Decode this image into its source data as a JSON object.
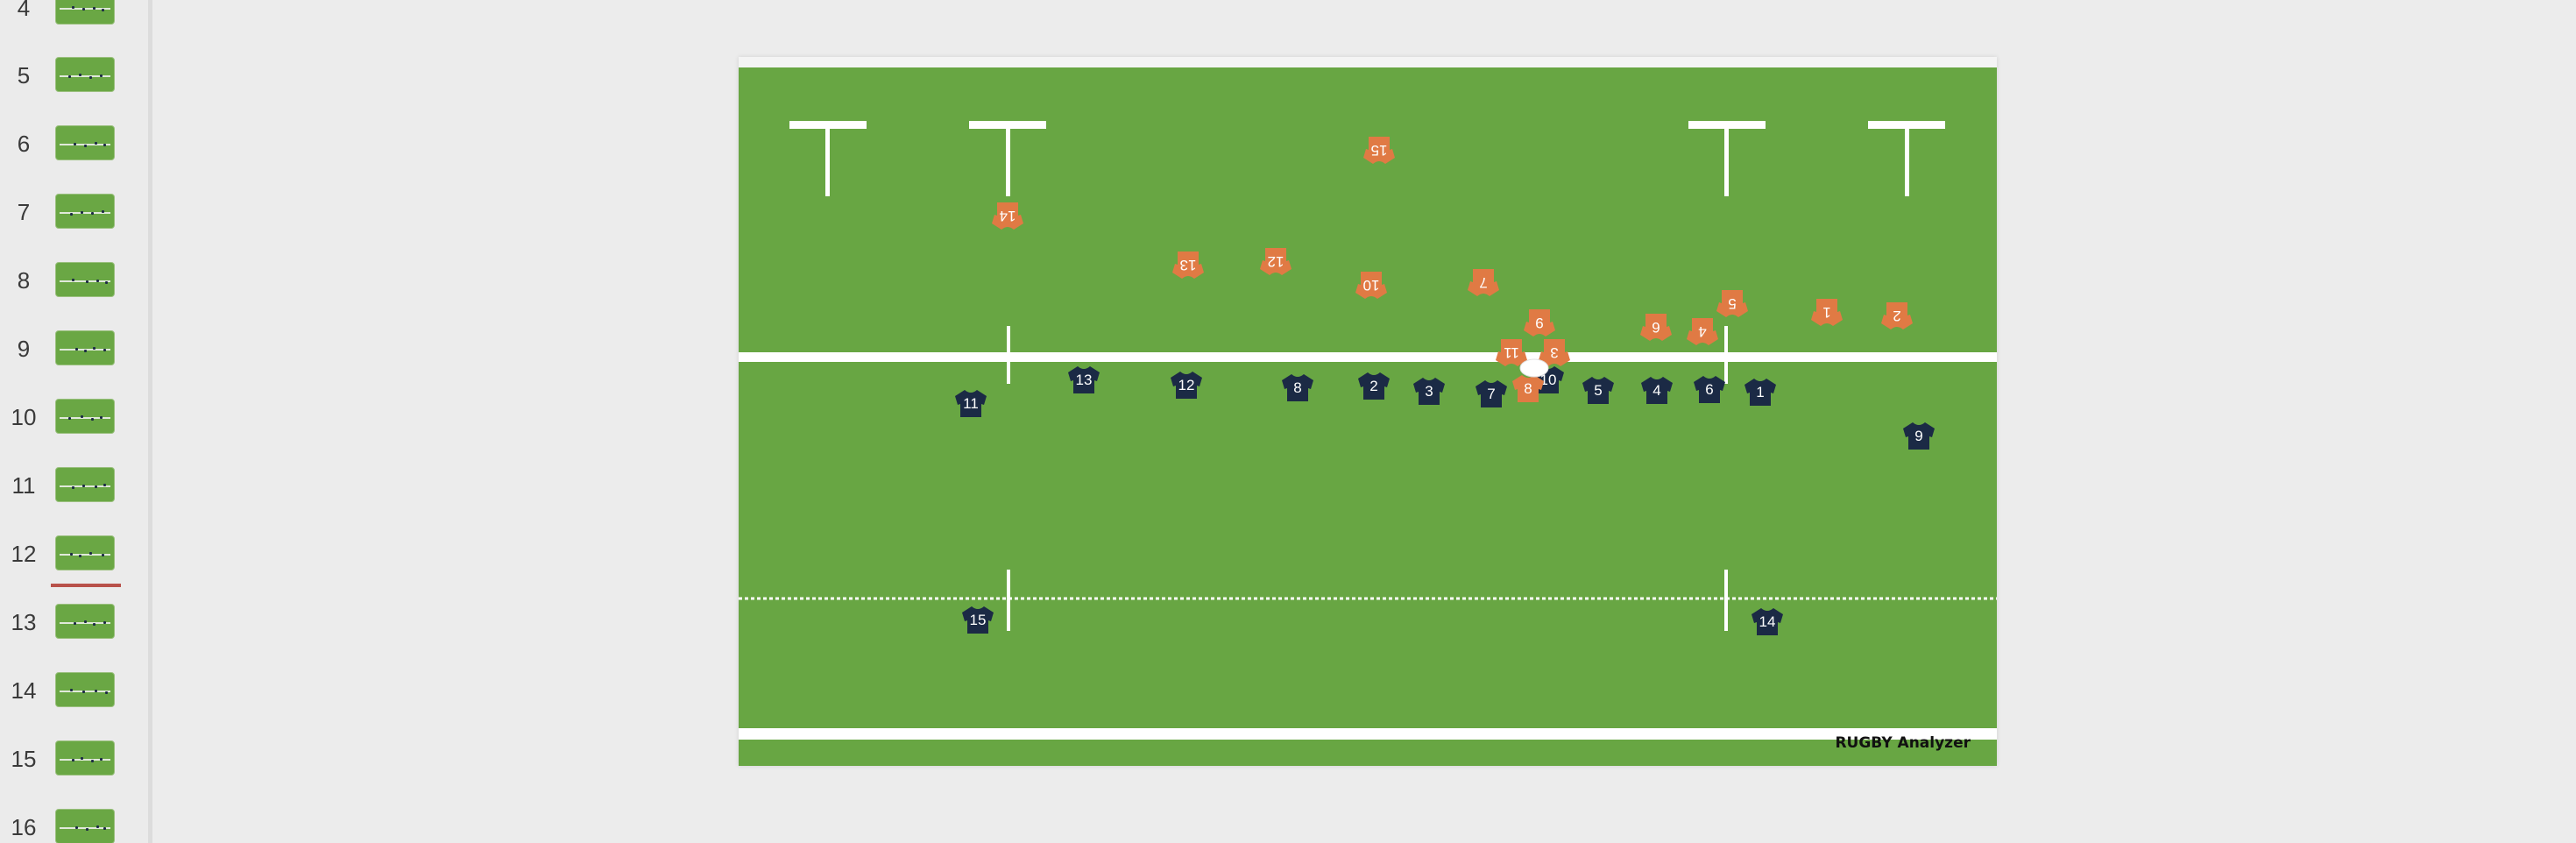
{
  "sidebar": {
    "slide_numbers": [
      "4",
      "5",
      "6",
      "7",
      "8",
      "9",
      "10",
      "11",
      "12",
      "13",
      "14",
      "15",
      "16"
    ]
  },
  "slide": {
    "watermark": "RUGBY Analyzer",
    "colors": {
      "field": "#68a643",
      "lines": "#ffffff",
      "attack": "#e07a44",
      "defence": "#1b2a45"
    },
    "team_orange": [
      "15",
      "14",
      "13",
      "12",
      "10",
      "7",
      "9",
      "6",
      "5",
      "4",
      "1",
      "2",
      "11",
      "3",
      "8"
    ],
    "team_navy": [
      "11",
      "13",
      "12",
      "8",
      "2",
      "3",
      "7",
      "10",
      "5",
      "4",
      "6",
      "1",
      "9",
      "15",
      "14"
    ]
  }
}
